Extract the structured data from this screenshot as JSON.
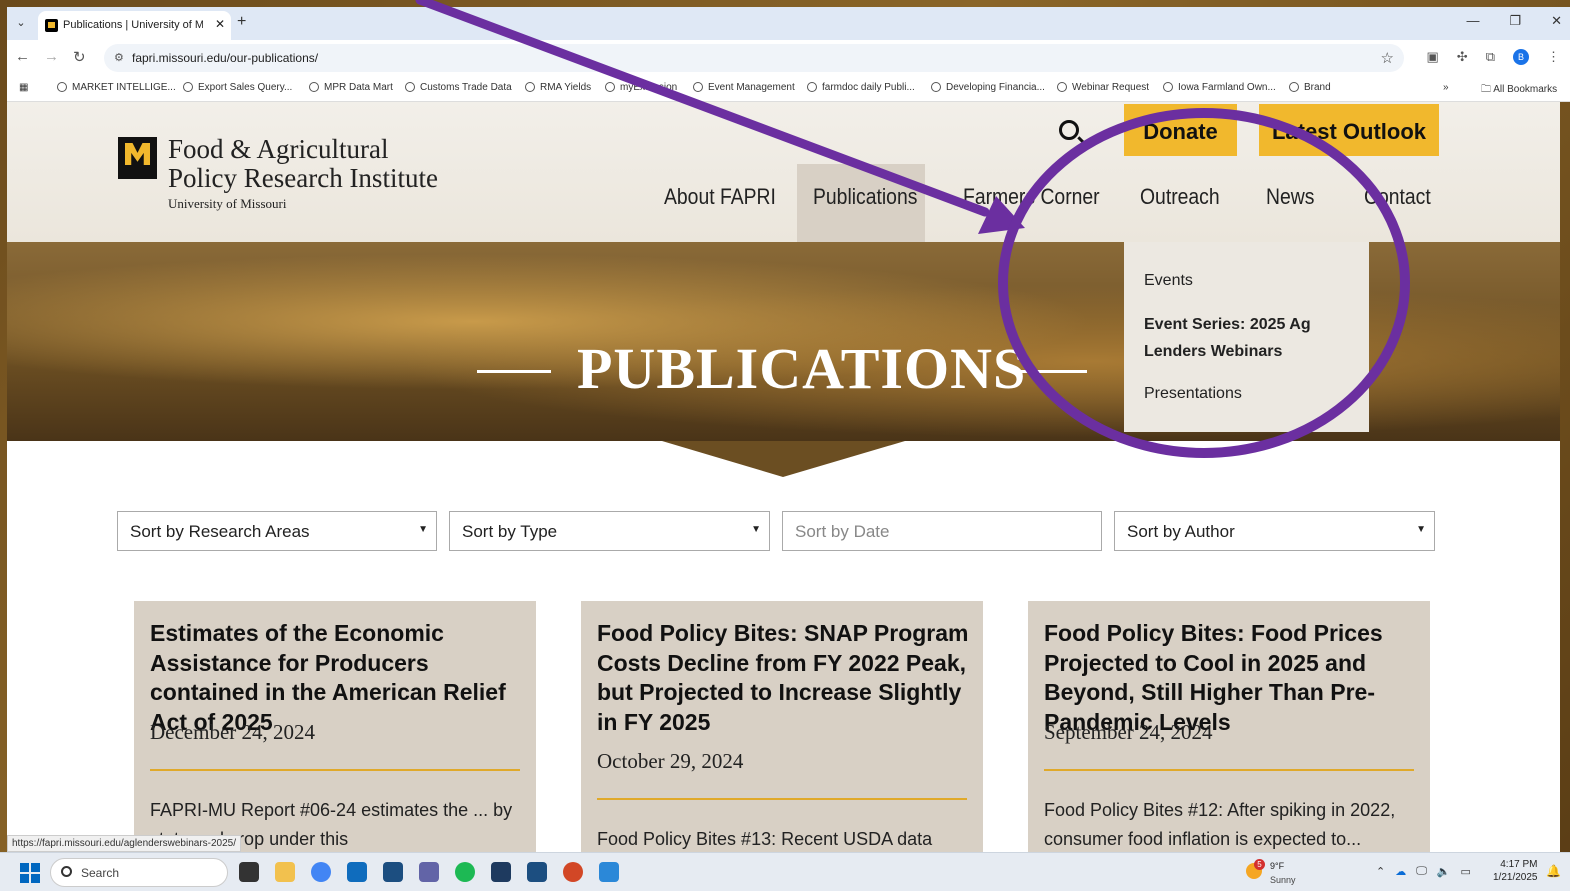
{
  "browser": {
    "tab_title": "Publications | University of Miss",
    "url": "fapri.missouri.edu/our-publications/",
    "bookmarks": [
      "MARKET INTELLIGE...",
      "Export Sales Query...",
      "MPR Data Mart",
      "Customs Trade Data",
      "RMA Yields",
      "myExtension",
      "Event Management",
      "farmdoc daily Publi...",
      "Developing Financia...",
      "Webinar Request",
      "Iowa Farmland Own...",
      "Brand"
    ],
    "all_bookmarks": "All Bookmarks",
    "profile_initial": "B",
    "status_url": "https://fapri.missouri.edu/aglenderswebinars-2025/"
  },
  "site": {
    "logo_line1": "Food & Agricultural",
    "logo_line2": "Policy Research Institute",
    "logo_line3": "University of Missouri",
    "donate": "Donate",
    "latest_outlook": "Latest Outlook",
    "nav": [
      "About FAPRI",
      "Publications",
      "Farmers Corner",
      "Outreach",
      "News",
      "Contact"
    ],
    "dropdown": [
      "Events",
      "Event Series: 2025 Ag Lenders Webinars",
      "Presentations"
    ],
    "hero_title": "PUBLICATIONS"
  },
  "filters": {
    "research_areas": "Sort by Research Areas",
    "type": "Sort by Type",
    "date_placeholder": "Sort by Date",
    "author": "Sort by Author"
  },
  "cards": [
    {
      "title": "Estimates of the Economic Assistance for Producers contained in the American Relief Act of 2025",
      "date": "December 24, 2024",
      "desc": "FAPRI-MU Report #06-24 estimates the ... by state and crop under this"
    },
    {
      "title": "Food Policy Bites: SNAP Program Costs Decline from FY 2022 Peak, but Projected to Increase Slightly in FY 2025",
      "date": "October 29, 2024",
      "desc": "Food Policy Bites #13: Recent USDA data"
    },
    {
      "title": "Food Policy Bites: Food Prices Projected to Cool in 2025 and Beyond, Still Higher Than Pre-Pandemic Levels",
      "date": "September 24, 2024",
      "desc": "Food Policy Bites #12: After spiking in 2022, consumer food inflation is expected to..."
    }
  ],
  "taskbar": {
    "search": "Search",
    "weather_temp": "9°F",
    "weather_cond": "Sunny",
    "weather_badge": "5",
    "time": "4:17 PM",
    "date": "1/21/2025"
  },
  "colors": {
    "annotation": "#6b2fa0",
    "gold": "#f1b82d",
    "card_bg": "#d8d0c5"
  }
}
